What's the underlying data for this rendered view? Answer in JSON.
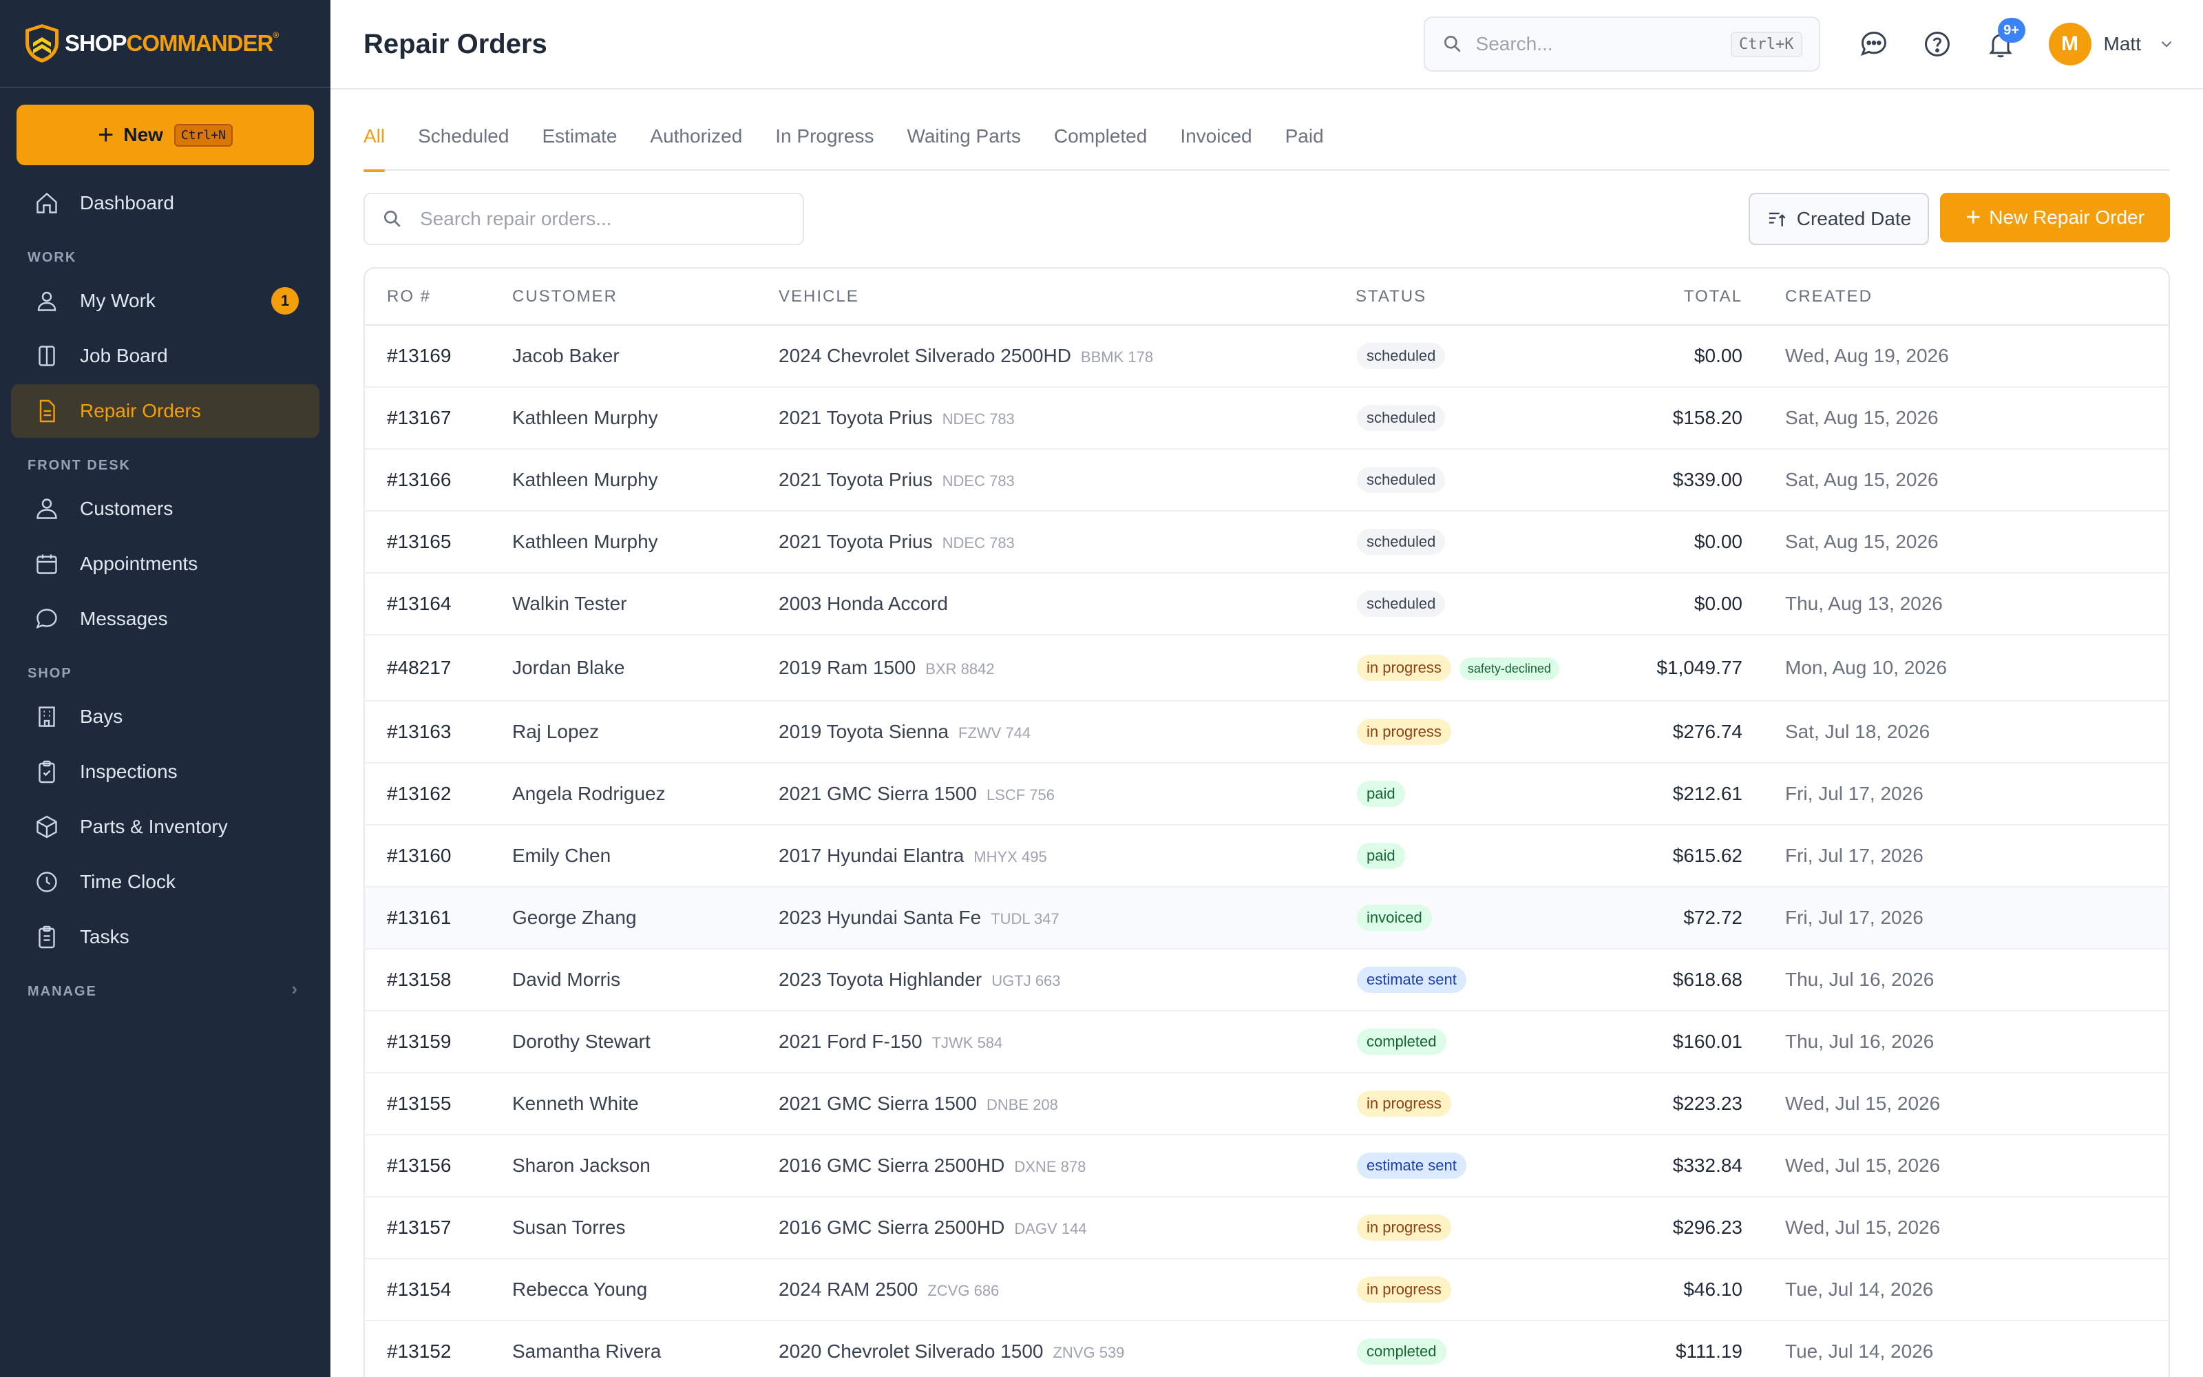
{
  "brand": {
    "name_part1": "SHOP",
    "name_part2": "COMMANDER",
    "mark": "®"
  },
  "sidebar": {
    "new_button": {
      "label": "New",
      "shortcut": "Ctrl+N"
    },
    "dashboard": "Dashboard",
    "sections": {
      "work": "WORK",
      "front_desk": "FRONT DESK",
      "shop": "SHOP",
      "manage": "MANAGE"
    },
    "items": {
      "my_work": {
        "label": "My Work",
        "badge": "1"
      },
      "job_board": "Job Board",
      "repair_orders": "Repair Orders",
      "customers": "Customers",
      "appointments": "Appointments",
      "messages": "Messages",
      "bays": "Bays",
      "inspections": "Inspections",
      "parts_inventory": "Parts & Inventory",
      "time_clock": "Time Clock",
      "tasks": "Tasks"
    }
  },
  "header": {
    "title": "Repair Orders",
    "search_placeholder": "Search...",
    "search_shortcut": "Ctrl+K",
    "notifications_badge": "9+",
    "user": {
      "initial": "M",
      "name": "Matt"
    }
  },
  "tabs": [
    "All",
    "Scheduled",
    "Estimate",
    "Authorized",
    "In Progress",
    "Waiting Parts",
    "Completed",
    "Invoiced",
    "Paid"
  ],
  "toolbar": {
    "search_placeholder": "Search repair orders...",
    "sort_label": "Created Date",
    "new_label": "New Repair Order"
  },
  "table": {
    "columns": {
      "ro": "RO #",
      "customer": "CUSTOMER",
      "vehicle": "VEHICLE",
      "status": "STATUS",
      "total": "TOTAL",
      "created": "CREATED"
    },
    "rows": [
      {
        "ro": "#13169",
        "customer": "Jacob Baker",
        "vehicle": "2024 Chevrolet Silverado 2500HD",
        "plate": "BBMK 178",
        "status": "scheduled",
        "status_class": "scheduled",
        "flag": "",
        "total": "$0.00",
        "created": "Wed, Aug 19, 2026"
      },
      {
        "ro": "#13167",
        "customer": "Kathleen Murphy",
        "vehicle": "2021 Toyota Prius",
        "plate": "NDEC 783",
        "status": "scheduled",
        "status_class": "scheduled",
        "flag": "",
        "total": "$158.20",
        "created": "Sat, Aug 15, 2026"
      },
      {
        "ro": "#13166",
        "customer": "Kathleen Murphy",
        "vehicle": "2021 Toyota Prius",
        "plate": "NDEC 783",
        "status": "scheduled",
        "status_class": "scheduled",
        "flag": "",
        "total": "$339.00",
        "created": "Sat, Aug 15, 2026"
      },
      {
        "ro": "#13165",
        "customer": "Kathleen Murphy",
        "vehicle": "2021 Toyota Prius",
        "plate": "NDEC 783",
        "status": "scheduled",
        "status_class": "scheduled",
        "flag": "",
        "total": "$0.00",
        "created": "Sat, Aug 15, 2026"
      },
      {
        "ro": "#13164",
        "customer": "Walkin Tester",
        "vehicle": "2003 Honda Accord",
        "plate": "",
        "status": "scheduled",
        "status_class": "scheduled",
        "flag": "",
        "total": "$0.00",
        "created": "Thu, Aug 13, 2026"
      },
      {
        "ro": "#48217",
        "customer": "Jordan Blake",
        "vehicle": "2019 Ram 1500",
        "plate": "BXR 8842",
        "status": "in progress",
        "status_class": "in-progress",
        "flag": "safety-declined",
        "total": "$1,049.77",
        "created": "Mon, Aug 10, 2026"
      },
      {
        "ro": "#13163",
        "customer": "Raj Lopez",
        "vehicle": "2019 Toyota Sienna",
        "plate": "FZWV 744",
        "status": "in progress",
        "status_class": "in-progress",
        "flag": "",
        "total": "$276.74",
        "created": "Sat, Jul 18, 2026"
      },
      {
        "ro": "#13162",
        "customer": "Angela Rodriguez",
        "vehicle": "2021 GMC Sierra 1500",
        "plate": "LSCF 756",
        "status": "paid",
        "status_class": "paid",
        "flag": "",
        "total": "$212.61",
        "created": "Fri, Jul 17, 2026"
      },
      {
        "ro": "#13160",
        "customer": "Emily Chen",
        "vehicle": "2017 Hyundai Elantra",
        "plate": "MHYX 495",
        "status": "paid",
        "status_class": "paid",
        "flag": "",
        "total": "$615.62",
        "created": "Fri, Jul 17, 2026"
      },
      {
        "ro": "#13161",
        "customer": "George Zhang",
        "vehicle": "2023 Hyundai Santa Fe",
        "plate": "TUDL 347",
        "status": "invoiced",
        "status_class": "invoiced",
        "flag": "",
        "total": "$72.72",
        "created": "Fri, Jul 17, 2026"
      },
      {
        "ro": "#13158",
        "customer": "David Morris",
        "vehicle": "2023 Toyota Highlander",
        "plate": "UGTJ 663",
        "status": "estimate sent",
        "status_class": "estimate-sent",
        "flag": "",
        "total": "$618.68",
        "created": "Thu, Jul 16, 2026"
      },
      {
        "ro": "#13159",
        "customer": "Dorothy Stewart",
        "vehicle": "2021 Ford F-150",
        "plate": "TJWK 584",
        "status": "completed",
        "status_class": "completed",
        "flag": "",
        "total": "$160.01",
        "created": "Thu, Jul 16, 2026"
      },
      {
        "ro": "#13155",
        "customer": "Kenneth White",
        "vehicle": "2021 GMC Sierra 1500",
        "plate": "DNBE 208",
        "status": "in progress",
        "status_class": "in-progress",
        "flag": "",
        "total": "$223.23",
        "created": "Wed, Jul 15, 2026"
      },
      {
        "ro": "#13156",
        "customer": "Sharon Jackson",
        "vehicle": "2016 GMC Sierra 2500HD",
        "plate": "DXNE 878",
        "status": "estimate sent",
        "status_class": "estimate-sent",
        "flag": "",
        "total": "$332.84",
        "created": "Wed, Jul 15, 2026"
      },
      {
        "ro": "#13157",
        "customer": "Susan Torres",
        "vehicle": "2016 GMC Sierra 2500HD",
        "plate": "DAGV 144",
        "status": "in progress",
        "status_class": "in-progress",
        "flag": "",
        "total": "$296.23",
        "created": "Wed, Jul 15, 2026"
      },
      {
        "ro": "#13154",
        "customer": "Rebecca Young",
        "vehicle": "2024 RAM 2500",
        "plate": "ZCVG 686",
        "status": "in progress",
        "status_class": "in-progress",
        "flag": "",
        "total": "$46.10",
        "created": "Tue, Jul 14, 2026"
      },
      {
        "ro": "#13152",
        "customer": "Samantha Rivera",
        "vehicle": "2020 Chevrolet Silverado 1500",
        "plate": "ZNVG 539",
        "status": "completed",
        "status_class": "completed",
        "flag": "",
        "total": "$111.19",
        "created": "Tue, Jul 14, 2026"
      }
    ]
  },
  "colors": {
    "accent": "#f59e0b",
    "sidebar_bg": "#1e293b",
    "badge_blue": "#3b82f6"
  }
}
